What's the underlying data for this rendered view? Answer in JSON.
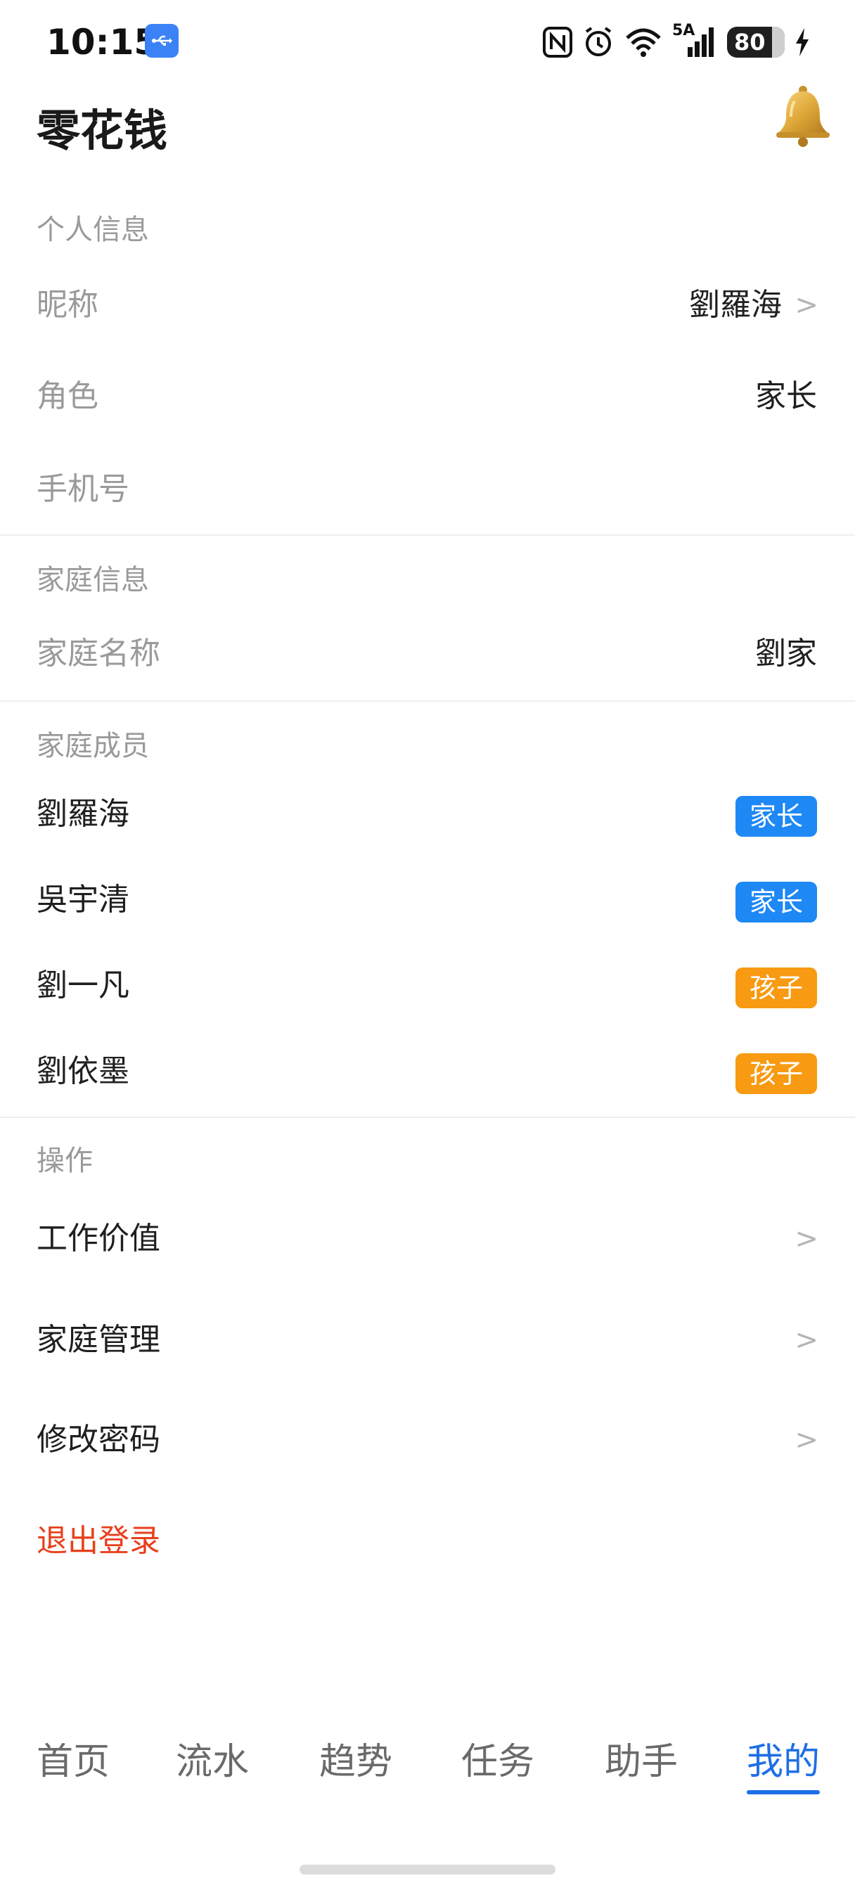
{
  "status_bar": {
    "time": "10:15",
    "network": "5A",
    "battery": "80",
    "icons": [
      "usb-icon",
      "nfc-icon",
      "alarm-icon",
      "wifi-icon",
      "signal-icon",
      "battery-icon",
      "charging-icon"
    ]
  },
  "header": {
    "title": "零花钱",
    "bell_icon": "bell-icon"
  },
  "personal": {
    "section_title": "个人信息",
    "nickname_label": "昵称",
    "nickname_value": "劉羅海",
    "role_label": "角色",
    "role_value": "家长",
    "phone_label": "手机号"
  },
  "family": {
    "section_title": "家庭信息",
    "name_label": "家庭名称",
    "name_value": "劉家"
  },
  "members": {
    "section_title": "家庭成员",
    "items": [
      {
        "name": "劉羅海",
        "role": "家长"
      },
      {
        "name": "吳宇清",
        "role": "家长"
      },
      {
        "name": "劉一凡",
        "role": "孩子"
      },
      {
        "name": "劉依墨",
        "role": "孩子"
      }
    ]
  },
  "actions": {
    "section_title": "操作",
    "items": [
      {
        "label": "工作价值",
        "chevron": ">"
      },
      {
        "label": "家庭管理",
        "chevron": ">"
      },
      {
        "label": "修改密码",
        "chevron": ">"
      }
    ],
    "logout": "退出登录"
  },
  "nickname_chevron": ">",
  "nav": {
    "tabs": [
      {
        "label": "首页"
      },
      {
        "label": "流水"
      },
      {
        "label": "趋势"
      },
      {
        "label": "任务"
      },
      {
        "label": "助手"
      },
      {
        "label": "我的"
      }
    ],
    "active_tab": "我的"
  },
  "colors": {
    "accent": "#1e6fe6",
    "parent_tag": "#1e88f5",
    "child_tag": "#f89a12",
    "logout": "#e8401c"
  }
}
